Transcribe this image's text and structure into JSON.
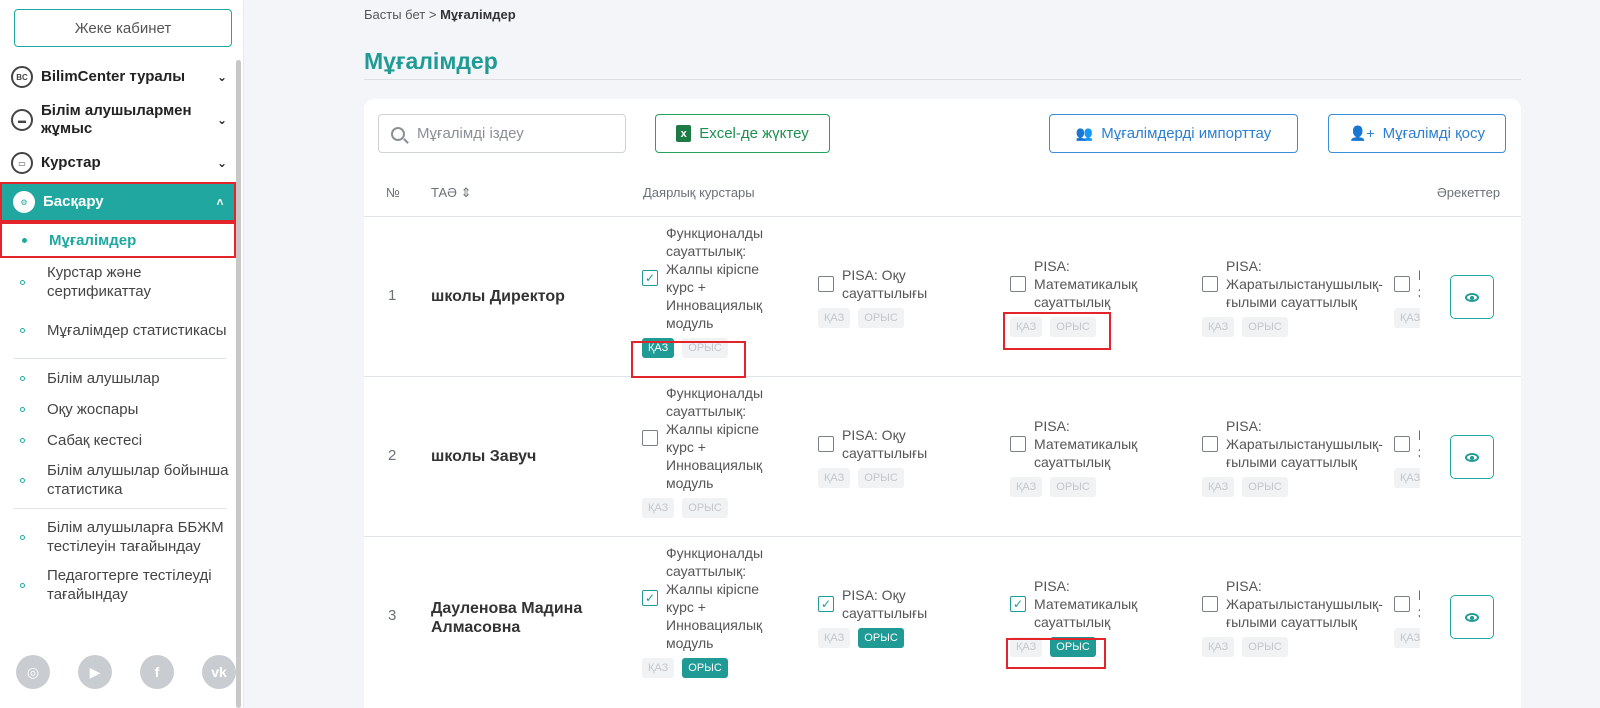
{
  "sidebar": {
    "cabinet": "Жеке кабинет",
    "menu": [
      {
        "label": "BilimCenter туралы",
        "icon": "bc-logo-icon"
      },
      {
        "label": "Білім алушылармен жұмыс",
        "icon": "briefcase-icon"
      },
      {
        "label": "Курстар",
        "icon": "monitor-icon"
      },
      {
        "label": "Басқару",
        "icon": "gear-icon"
      }
    ],
    "sub_items": [
      {
        "label": "Мұғалімдер"
      },
      {
        "label": "Курстар және сертификаттау"
      },
      {
        "label": "Мұғалімдер статистикасы"
      },
      {
        "label": "Білім алушылар"
      },
      {
        "label": "Оқу жоспары"
      },
      {
        "label": "Сабақ кестесі"
      },
      {
        "label": "Білім алушылар бойынша статистика"
      },
      {
        "label": "Білім алушыларға ББЖМ тестілеуін тағайындау"
      },
      {
        "label": "Педагогтерге тестілеуді тағайындау"
      }
    ],
    "socials": [
      "instagram-icon",
      "youtube-icon",
      "facebook-icon",
      "vk-icon"
    ]
  },
  "breadcrumb": {
    "home": "Басты бет",
    "separator": ">",
    "current": "Мұғалімдер"
  },
  "page": {
    "title": "Мұғалімдер"
  },
  "toolbar": {
    "search_placeholder": "Мұғалімді іздеу",
    "excel": "Excel-де жүктеу",
    "import": "Мұғалімдерді импорттау",
    "add": "Мұғалімді қосу"
  },
  "table": {
    "headers": {
      "num": "№",
      "name": "ТАӘ",
      "courses": "Даярлық курстары",
      "actions": "Әрекеттер"
    },
    "courses": [
      "Функционалды\nсауаттылық:\nЖалпы кіріспе\nкурс +\nИнновациялық\nмодуль",
      "PISA: Оқу\nсауаттылығы",
      "PISA:\nМатематикалық\nсауаттылық",
      "PISA:\nЖаратылыстанушылық-\nғылыми сауаттылық",
      "PISA:\nЗ"
    ],
    "lang_kz": "ҚАЗ",
    "lang_ru": "ОРЫС",
    "rows": [
      {
        "num": "1",
        "name": "школы Директор",
        "checked": [
          true,
          false,
          false,
          false,
          false
        ],
        "langs": [
          [
            "kz"
          ],
          [],
          [],
          [],
          []
        ]
      },
      {
        "num": "2",
        "name": "школы Завуч",
        "checked": [
          false,
          false,
          false,
          false,
          false
        ],
        "langs": [
          [],
          [],
          [],
          [],
          []
        ]
      },
      {
        "num": "3",
        "name": "Дауленова Мадина Алмасовна",
        "checked": [
          true,
          true,
          true,
          false,
          false
        ],
        "langs": [
          [
            "ru"
          ],
          [
            "ru"
          ],
          [
            "ru"
          ],
          [],
          []
        ]
      }
    ]
  },
  "colors": {
    "accent": "#20a8a0",
    "highlight": "#e3242b",
    "blue": "#2b7fd0",
    "excel": "#1d8f4f"
  }
}
